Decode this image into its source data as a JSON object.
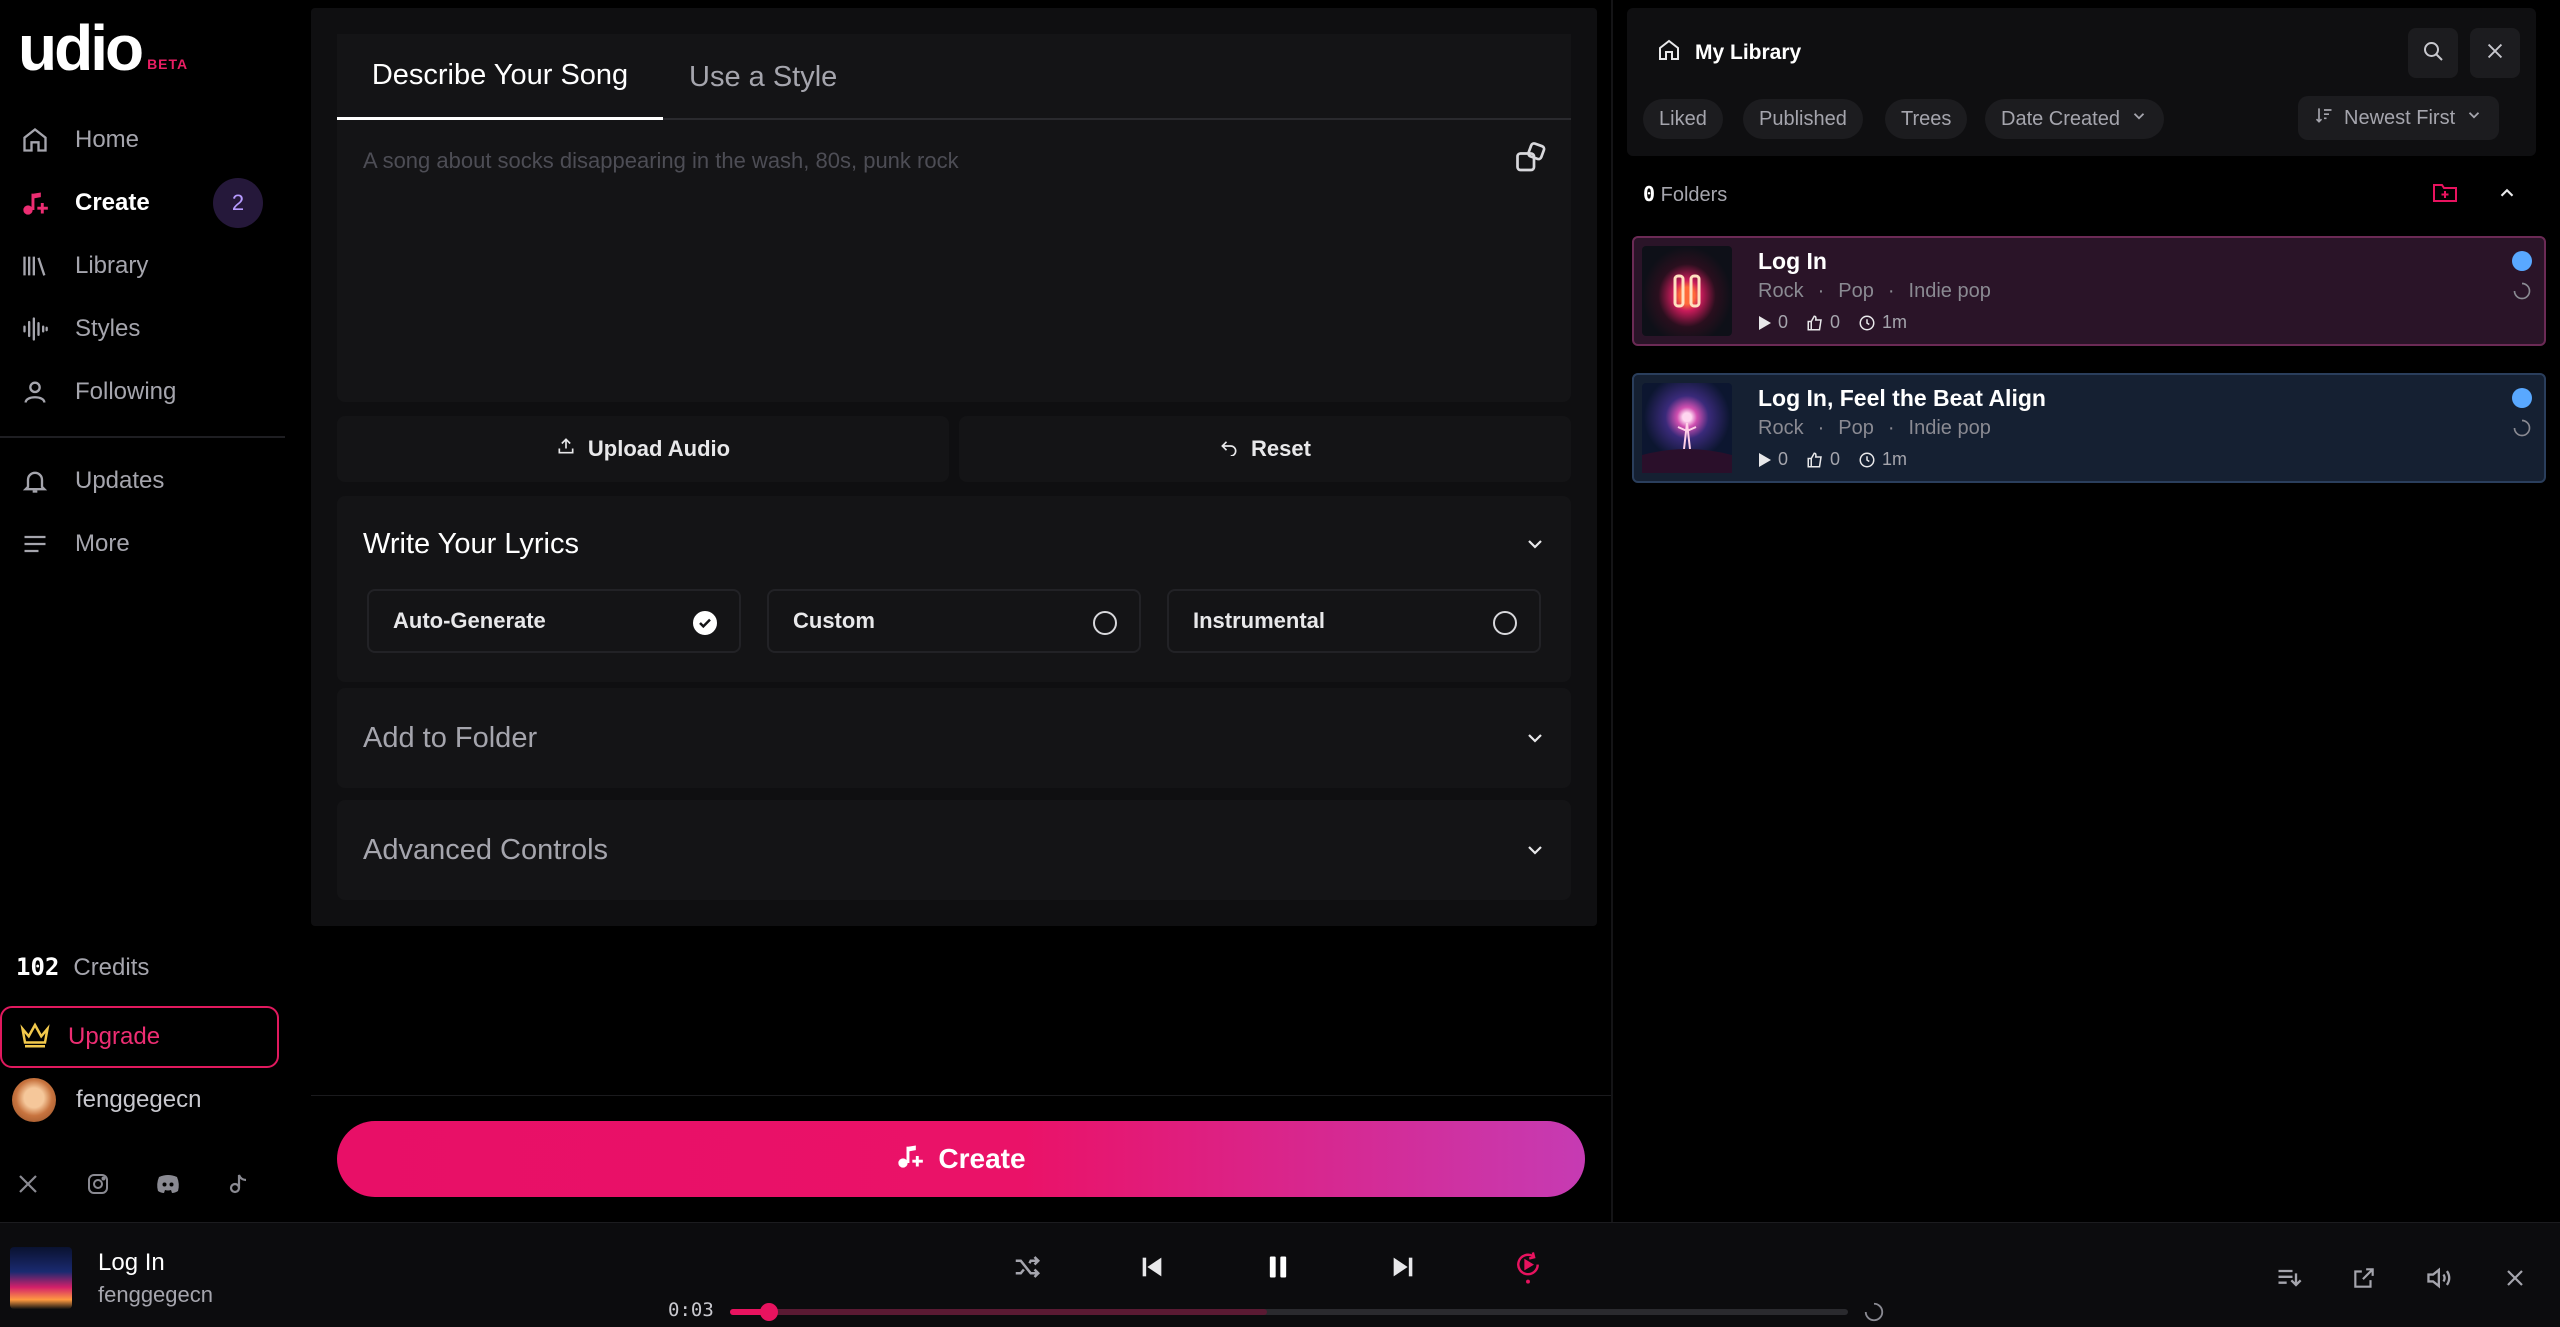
{
  "brand": {
    "name": "udio",
    "tag": "BETA"
  },
  "nav": {
    "home": "Home",
    "create": "Create",
    "create_badge": "2",
    "library": "Library",
    "styles": "Styles",
    "following": "Following",
    "updates": "Updates",
    "more": "More"
  },
  "account": {
    "credits_count": "102",
    "credits_label": "Credits",
    "upgrade": "Upgrade",
    "username": "fenggegecn"
  },
  "socials": [
    "x-icon",
    "instagram-icon",
    "discord-icon",
    "tiktok-icon"
  ],
  "composer": {
    "tab_describe": "Describe Your Song",
    "tab_style": "Use a Style",
    "prompt_placeholder": "A song about socks disappearing in the wash, 80s, punk rock",
    "upload_audio": "Upload Audio",
    "reset": "Reset",
    "lyrics_title": "Write Your Lyrics",
    "lyrics_options": [
      "Auto-Generate",
      "Custom",
      "Instrumental"
    ],
    "lyrics_selected": "Auto-Generate",
    "folder_title": "Add to Folder",
    "advanced_title": "Advanced Controls",
    "create_button": "Create"
  },
  "library": {
    "title": "My Library",
    "filters": [
      "Liked",
      "Published",
      "Trees",
      "Date Created"
    ],
    "sort": "Newest First",
    "folders_count": "0",
    "folders_label": "Folders",
    "songs": [
      {
        "title": "Log In",
        "tags": [
          "Rock",
          "Pop",
          "Indie pop"
        ],
        "plays": "0",
        "likes": "0",
        "duration": "1m"
      },
      {
        "title": "Log In, Feel the Beat Align",
        "tags": [
          "Rock",
          "Pop",
          "Indie pop"
        ],
        "plays": "0",
        "likes": "0",
        "duration": "1m"
      }
    ]
  },
  "player": {
    "title": "Log In",
    "artist": "fenggegecn",
    "elapsed": "0:03",
    "progress_fraction": 0.035,
    "buffered_fraction": 0.48
  },
  "colors": {
    "accent": "#e8135f",
    "background": "#000000",
    "panel": "#141416",
    "selected_song_bg": "#2a1428",
    "second_song_bg": "#152032",
    "status_dot": "#59a8ff"
  }
}
